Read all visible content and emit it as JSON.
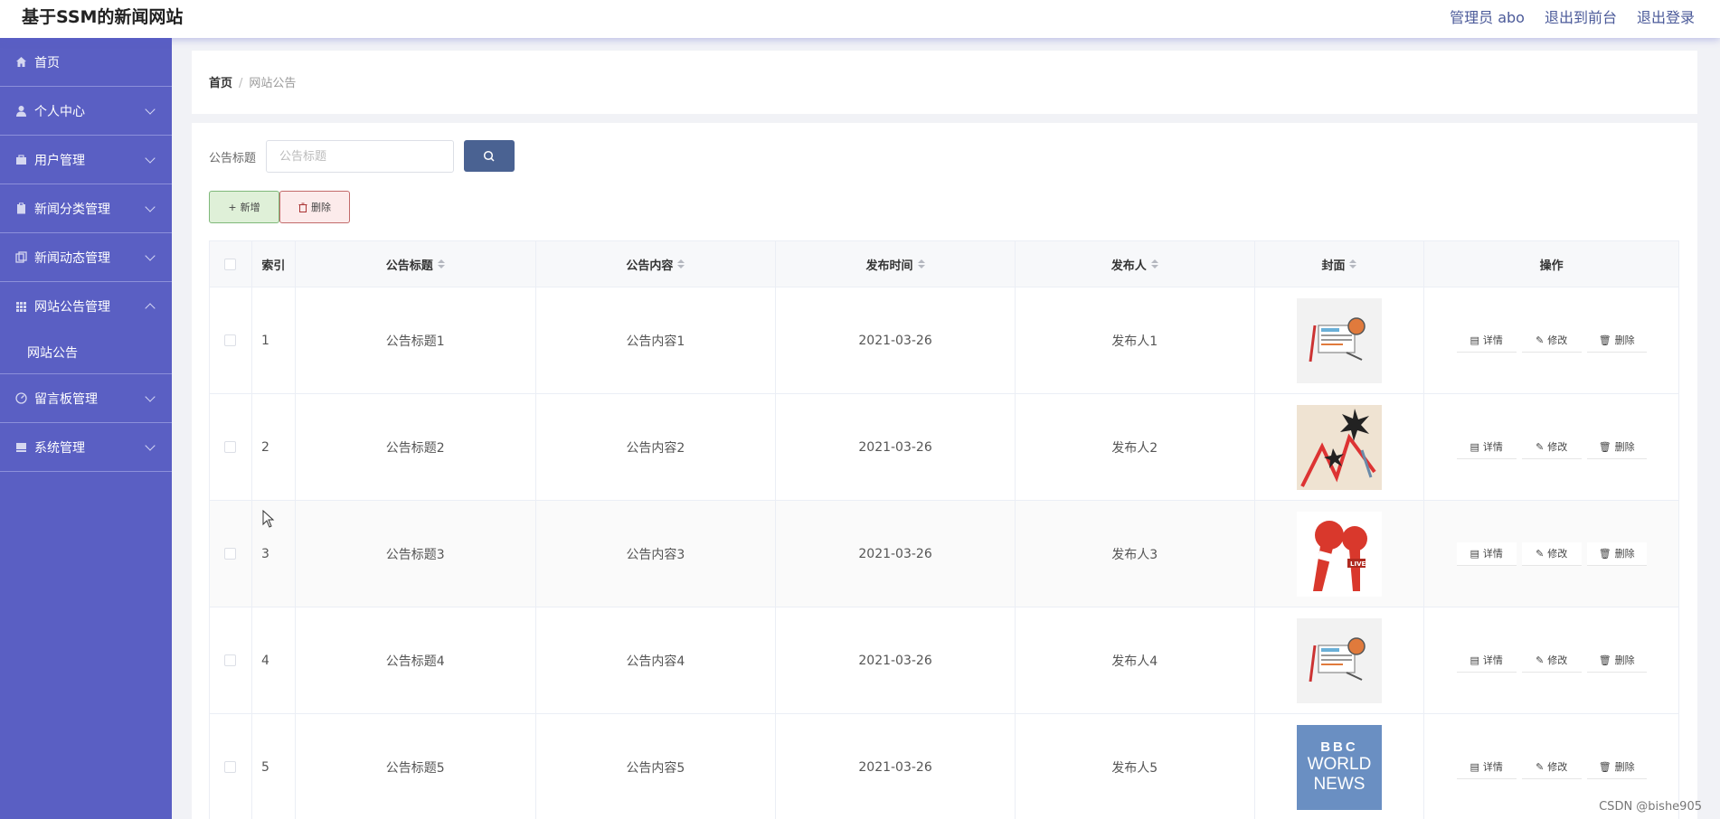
{
  "header": {
    "brand": "基于SSM的新闻网站",
    "admin_label": "管理员 abo",
    "front_label": "退出到前台",
    "logout_label": "退出登录"
  },
  "sidebar": {
    "items": [
      {
        "label": "首页",
        "icon": "home-icon",
        "has_children": false
      },
      {
        "label": "个人中心",
        "icon": "user-icon",
        "has_children": true
      },
      {
        "label": "用户管理",
        "icon": "briefcase-icon",
        "has_children": true
      },
      {
        "label": "新闻分类管理",
        "icon": "clipboard-icon",
        "has_children": true
      },
      {
        "label": "新闻动态管理",
        "icon": "copy-icon",
        "has_children": true
      },
      {
        "label": "网站公告管理",
        "icon": "grid-icon",
        "has_children": true,
        "expanded": true
      },
      {
        "label": "留言板管理",
        "icon": "dashboard-icon",
        "has_children": true
      },
      {
        "label": "系统管理",
        "icon": "drive-icon",
        "has_children": true
      }
    ],
    "sub_item": "网站公告"
  },
  "breadcrumb": {
    "home": "首页",
    "current": "网站公告"
  },
  "search": {
    "label": "公告标题",
    "placeholder": "公告标题"
  },
  "toolbar": {
    "add_label": "新增",
    "delete_label": "删除"
  },
  "table": {
    "headers": {
      "index": "索引",
      "title": "公告标题",
      "content": "公告内容",
      "time": "发布时间",
      "publisher": "发布人",
      "cover": "封面",
      "ops": "操作"
    },
    "rows": [
      {
        "index": "1",
        "title": "公告标题1",
        "content": "公告内容1",
        "time": "2021-03-26",
        "publisher": "发布人1",
        "cover": "news-tablet"
      },
      {
        "index": "2",
        "title": "公告标题2",
        "content": "公告内容2",
        "time": "2021-03-26",
        "publisher": "发布人2",
        "cover": "news-chart"
      },
      {
        "index": "3",
        "title": "公告标题3",
        "content": "公告内容3",
        "time": "2021-03-26",
        "publisher": "发布人3",
        "cover": "news-microphone"
      },
      {
        "index": "4",
        "title": "公告标题4",
        "content": "公告内容4",
        "time": "2021-03-26",
        "publisher": "发布人4",
        "cover": "news-tablet"
      },
      {
        "index": "5",
        "title": "公告标题5",
        "content": "公告内容5",
        "time": "2021-03-26",
        "publisher": "发布人5",
        "cover": "bbc-news"
      }
    ],
    "op_labels": {
      "detail": "详情",
      "edit": "修改",
      "delete": "删除"
    }
  },
  "bbc_logo": {
    "line1": "BBC",
    "line2": "WORLD",
    "line3": "NEWS"
  },
  "watermark": "CSDN @bishe905",
  "colors": {
    "sidebar": "#5a5fc3",
    "search_button": "#4a6292",
    "add_button": "#dff0d8",
    "delete_button": "#fcebeb"
  }
}
